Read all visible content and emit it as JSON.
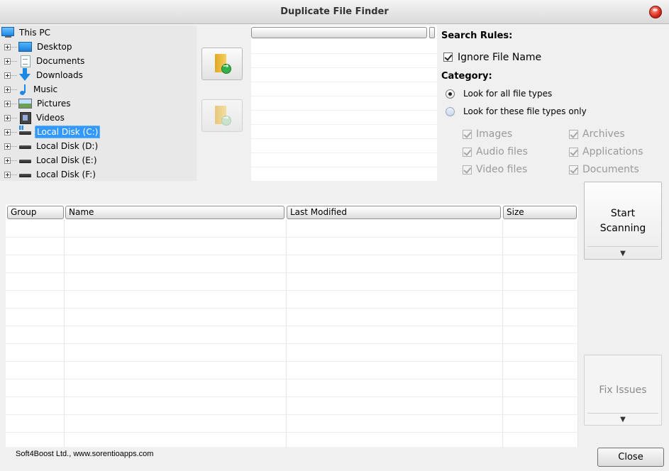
{
  "window": {
    "title": "Duplicate File Finder"
  },
  "tree": {
    "root": "This PC",
    "items": [
      {
        "label": "Desktop",
        "icon": "desktop-icon"
      },
      {
        "label": "Documents",
        "icon": "documents-icon"
      },
      {
        "label": "Downloads",
        "icon": "downloads-icon"
      },
      {
        "label": "Music",
        "icon": "music-icon"
      },
      {
        "label": "Pictures",
        "icon": "pictures-icon"
      },
      {
        "label": "Videos",
        "icon": "videos-icon"
      },
      {
        "label": "Local Disk (C:)",
        "icon": "system-disk-icon",
        "selected": true
      },
      {
        "label": "Local Disk (D:)",
        "icon": "disk-icon"
      },
      {
        "label": "Local Disk (E:)",
        "icon": "disk-icon"
      },
      {
        "label": "Local Disk (F:)",
        "icon": "disk-icon"
      }
    ]
  },
  "search_rules": {
    "title": "Search Rules:",
    "ignore_file_name": {
      "label": "Ignore File Name",
      "checked": true
    },
    "category_title": "Category:",
    "radio_all": {
      "label": "Look for all file types",
      "selected": true
    },
    "radio_only": {
      "label": "Look for these file types only",
      "selected": false
    },
    "file_types": [
      {
        "label": "Images",
        "checked": true
      },
      {
        "label": "Archives",
        "checked": true
      },
      {
        "label": "Audio files",
        "checked": true
      },
      {
        "label": "Applications",
        "checked": true
      },
      {
        "label": "Video files",
        "checked": true
      },
      {
        "label": "Documents",
        "checked": true
      }
    ]
  },
  "actions": {
    "start_line1": "Start",
    "start_line2": "Scanning",
    "fix": "Fix Issues",
    "dropdown_glyph": "▼"
  },
  "results": {
    "columns": [
      "Group",
      "Name",
      "Last Modified",
      "Size"
    ]
  },
  "footer": {
    "credit": "Soft4Boost Ltd., www.sorentioapps.com",
    "close_label": "Close"
  },
  "colors": {
    "selection": "#3399ff",
    "close_orb": "#d6261a"
  }
}
